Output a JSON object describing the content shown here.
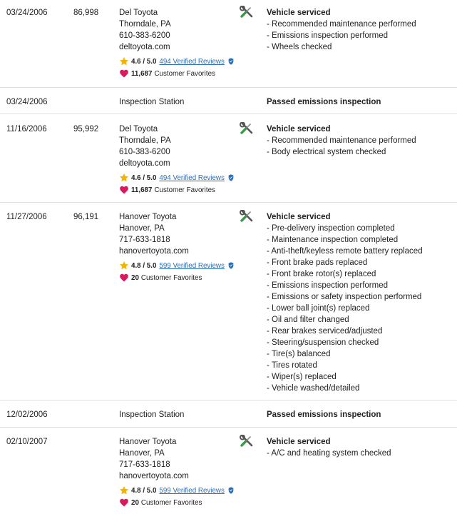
{
  "colors": {
    "star": "#f5b301",
    "heart": "#d81b60",
    "link": "#2a6ebb",
    "verified": "#2a6ebb",
    "wrench": "#555555",
    "screwdriver_handle": "#3a9a46"
  },
  "records": [
    {
      "date": "03/24/2006",
      "mileage": "86,998",
      "source": [
        "Del Toyota",
        "Thorndale, PA",
        "610-383-6200",
        "deltoyota.com"
      ],
      "rating": {
        "score": "4.6 / 5.0",
        "reviews": "494 Verified Reviews",
        "favorites": "11,687",
        "favorites_label": "Customer Favorites"
      },
      "icon": "service-tools-icon",
      "title": "Vehicle serviced",
      "items": [
        "- Recommended maintenance performed",
        "- Emissions inspection performed",
        "- Wheels checked"
      ]
    },
    {
      "date": "03/24/2006",
      "mileage": "",
      "source": [
        "Inspection Station"
      ],
      "title": "Passed emissions inspection",
      "items": []
    },
    {
      "date": "11/16/2006",
      "mileage": "95,992",
      "source": [
        "Del Toyota",
        "Thorndale, PA",
        "610-383-6200",
        "deltoyota.com"
      ],
      "rating": {
        "score": "4.6 / 5.0",
        "reviews": "494 Verified Reviews",
        "favorites": "11,687",
        "favorites_label": "Customer Favorites"
      },
      "icon": "service-tools-icon",
      "title": "Vehicle serviced",
      "items": [
        "- Recommended maintenance performed",
        "- Body electrical system checked"
      ]
    },
    {
      "date": "11/27/2006",
      "mileage": "96,191",
      "source": [
        "Hanover Toyota",
        "Hanover, PA",
        "717-633-1818",
        "hanovertoyota.com"
      ],
      "rating": {
        "score": "4.8 / 5.0",
        "reviews": "599 Verified Reviews",
        "favorites": "20",
        "favorites_label": "Customer Favorites"
      },
      "icon": "service-tools-icon",
      "title": "Vehicle serviced",
      "items": [
        "- Pre-delivery inspection completed",
        "- Maintenance inspection completed",
        "- Anti-theft/keyless remote battery replaced",
        "- Front brake pads replaced",
        "- Front brake rotor(s) replaced",
        "- Emissions inspection performed",
        "- Emissions or safety inspection performed",
        "- Lower ball joint(s) replaced",
        "- Oil and filter changed",
        "- Rear brakes serviced/adjusted",
        "- Steering/suspension checked",
        "- Tire(s) balanced",
        "- Tires rotated",
        "- Wiper(s) replaced",
        "- Vehicle washed/detailed"
      ]
    },
    {
      "date": "12/02/2006",
      "mileage": "",
      "source": [
        "Inspection Station"
      ],
      "title": "Passed emissions inspection",
      "items": []
    },
    {
      "date": "02/10/2007",
      "mileage": "",
      "source": [
        "Hanover Toyota",
        "Hanover, PA",
        "717-633-1818",
        "hanovertoyota.com"
      ],
      "rating": {
        "score": "4.8 / 5.0",
        "reviews": "599 Verified Reviews",
        "favorites": "20",
        "favorites_label": "Customer Favorites"
      },
      "icon": "service-tools-icon",
      "title": "Vehicle serviced",
      "items": [
        "- A/C and heating system checked"
      ]
    }
  ]
}
